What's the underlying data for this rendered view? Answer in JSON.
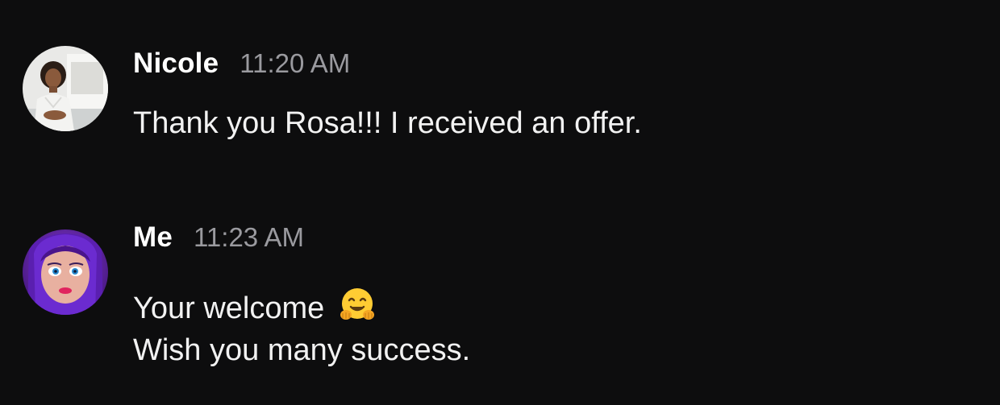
{
  "messages": [
    {
      "author": "Nicole",
      "time": "11:20 AM",
      "avatar_icon": "nicole-avatar",
      "lines": [
        "Thank you Rosa!!! I received an offer."
      ]
    },
    {
      "author": "Me",
      "time": "11:23 AM",
      "avatar_icon": "me-avatar",
      "lines": [
        "Your welcome",
        "Wish you many success."
      ],
      "emoji": "hugging-face-emoji"
    }
  ],
  "colors": {
    "background": "#0d0d0e",
    "author": "#ffffff",
    "timestamp": "#9a9a9f",
    "text": "#f2f2f2"
  }
}
